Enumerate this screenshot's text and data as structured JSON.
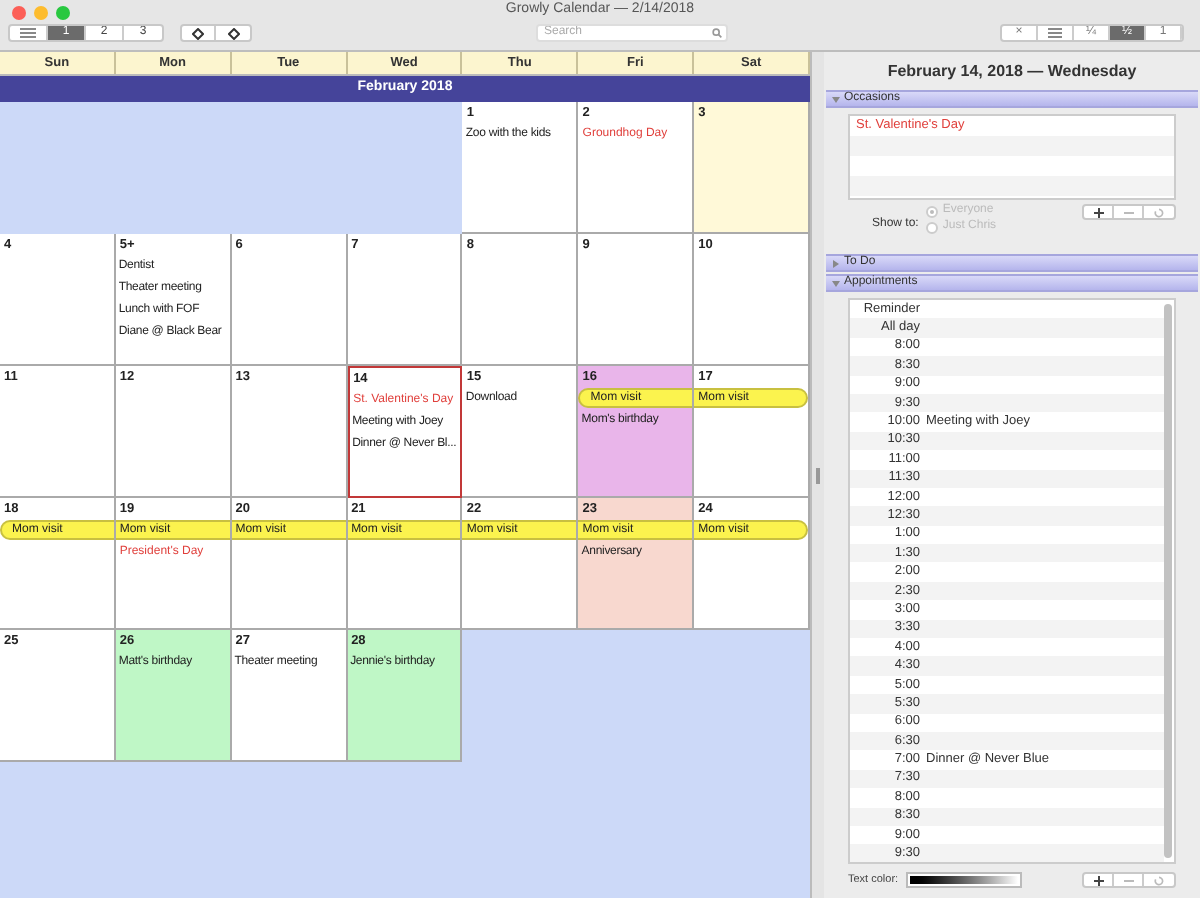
{
  "window": {
    "title": "Growly Calendar — 2/14/2018"
  },
  "toolbar": {
    "view_tabs": [
      {
        "label": "1",
        "selected": true
      },
      {
        "label": "2",
        "selected": false
      },
      {
        "label": "3",
        "selected": false
      }
    ],
    "search": {
      "placeholder": "Search"
    },
    "zoom_tabs": [
      {
        "label": "×",
        "selected": false
      },
      {
        "label": "¼",
        "selected": false
      },
      {
        "label": "½",
        "selected": true
      },
      {
        "label": "1",
        "selected": false
      }
    ]
  },
  "calendar": {
    "weekdays": [
      "Sun",
      "Mon",
      "Tue",
      "Wed",
      "Thu",
      "Fri",
      "Sat"
    ],
    "month": "February 2018",
    "weeks": [
      [
        {
          "kind": "blank"
        },
        {
          "kind": "blank"
        },
        {
          "kind": "blank"
        },
        {
          "kind": "blank"
        },
        {
          "kind": "day",
          "day": "1",
          "selected": false,
          "events": [
            {
              "kind": "plain",
              "text": "Zoo with the kids"
            }
          ]
        },
        {
          "kind": "day",
          "day": "2",
          "selected": false,
          "events": [
            {
              "kind": "holiday",
              "text": "Groundhog Day"
            }
          ]
        },
        {
          "kind": "day",
          "day": "3",
          "selected": false,
          "color": "#fff9d8"
        }
      ],
      [
        {
          "kind": "day",
          "day": "4",
          "selected": false
        },
        {
          "kind": "day",
          "day": "5+",
          "selected": false,
          "events": [
            {
              "kind": "plain",
              "text": "Dentist"
            },
            {
              "kind": "plain",
              "text": "Theater meeting"
            },
            {
              "kind": "plain",
              "text": "Lunch with FOF"
            },
            {
              "kind": "plain",
              "text": "Diane @ Black Bear"
            }
          ]
        },
        {
          "kind": "day",
          "day": "6",
          "selected": false
        },
        {
          "kind": "day",
          "day": "7",
          "selected": false
        },
        {
          "kind": "day",
          "day": "8",
          "selected": false
        },
        {
          "kind": "day",
          "day": "9",
          "selected": false
        },
        {
          "kind": "day",
          "day": "10",
          "selected": false
        }
      ],
      [
        {
          "kind": "day",
          "day": "11",
          "selected": false
        },
        {
          "kind": "day",
          "day": "12",
          "selected": false
        },
        {
          "kind": "day",
          "day": "13",
          "selected": false
        },
        {
          "kind": "day",
          "day": "14",
          "selected": true,
          "events": [
            {
              "kind": "holiday",
              "text": "St. Valentine's Day"
            },
            {
              "kind": "plain",
              "text": "Meeting with Joey"
            },
            {
              "kind": "plain",
              "text": "Dinner @ Never Bl..."
            }
          ]
        },
        {
          "kind": "day",
          "day": "15",
          "selected": false,
          "events": [
            {
              "kind": "plain",
              "text": "Download"
            }
          ]
        },
        {
          "kind": "day",
          "day": "16",
          "selected": false,
          "color": "#e9b5ea",
          "events": [
            {
              "kind": "span",
              "text": "Mom visit"
            },
            {
              "kind": "plain",
              "text": "Mom's birthday"
            }
          ]
        },
        {
          "kind": "day",
          "day": "17",
          "selected": false,
          "events": [
            {
              "kind": "span",
              "text": "Mom visit"
            }
          ]
        }
      ],
      [
        {
          "kind": "day",
          "day": "18",
          "selected": false,
          "events": [
            {
              "kind": "span",
              "text": "Mom visit"
            }
          ]
        },
        {
          "kind": "day",
          "day": "19",
          "selected": false,
          "events": [
            {
              "kind": "span",
              "text": "Mom visit"
            },
            {
              "kind": "holiday",
              "text": "President's Day"
            }
          ]
        },
        {
          "kind": "day",
          "day": "20",
          "selected": false,
          "events": [
            {
              "kind": "span",
              "text": "Mom visit"
            }
          ]
        },
        {
          "kind": "day",
          "day": "21",
          "selected": false,
          "events": [
            {
              "kind": "span",
              "text": "Mom visit"
            }
          ]
        },
        {
          "kind": "day",
          "day": "22",
          "selected": false,
          "events": [
            {
              "kind": "span",
              "text": "Mom visit"
            }
          ]
        },
        {
          "kind": "day",
          "day": "23",
          "selected": false,
          "color": "#f8d8cf",
          "events": [
            {
              "kind": "span",
              "text": "Mom visit"
            },
            {
              "kind": "plain",
              "text": "Anniversary"
            }
          ]
        },
        {
          "kind": "day",
          "day": "24",
          "selected": false,
          "events": [
            {
              "kind": "span",
              "text": "Mom visit"
            }
          ]
        }
      ],
      [
        {
          "kind": "day",
          "day": "25",
          "selected": false
        },
        {
          "kind": "day",
          "day": "26",
          "selected": false,
          "color": "#bff7c6",
          "events": [
            {
              "kind": "plain",
              "text": "Matt's birthday"
            }
          ]
        },
        {
          "kind": "day",
          "day": "27",
          "selected": false,
          "events": [
            {
              "kind": "plain",
              "text": "Theater meeting"
            }
          ]
        },
        {
          "kind": "day",
          "day": "28",
          "selected": false,
          "color": "#bff7c6",
          "events": [
            {
              "kind": "plain",
              "text": "Jennie's birthday"
            }
          ]
        },
        {
          "kind": "blank"
        },
        {
          "kind": "blank"
        },
        {
          "kind": "blank"
        }
      ]
    ]
  },
  "detail": {
    "date": "February 14, 2018 — Wednesday",
    "occasions": {
      "title": "Occasions",
      "expanded": true,
      "items": [
        "St. Valentine's Day"
      ],
      "show_to_label": "Show to:",
      "options": [
        {
          "label": "Everyone",
          "selected": true,
          "disabled": true
        },
        {
          "label": "Just Chris",
          "selected": false,
          "disabled": true
        }
      ]
    },
    "todo": {
      "title": "To Do",
      "expanded": false
    },
    "appointments": {
      "title": "Appointments",
      "expanded": true,
      "rows": [
        {
          "time": "Reminder"
        },
        {
          "time": "All day"
        },
        {
          "time": "8:00"
        },
        {
          "time": "8:30"
        },
        {
          "time": "9:00"
        },
        {
          "time": "9:30"
        },
        {
          "time": "10:00",
          "text": "Meeting with Joey"
        },
        {
          "time": "10:30"
        },
        {
          "time": "11:00"
        },
        {
          "time": "11:30"
        },
        {
          "time": "12:00"
        },
        {
          "time": "12:30"
        },
        {
          "time": "1:00"
        },
        {
          "time": "1:30"
        },
        {
          "time": "2:00"
        },
        {
          "time": "2:30"
        },
        {
          "time": "3:00"
        },
        {
          "time": "3:30"
        },
        {
          "time": "4:00"
        },
        {
          "time": "4:30"
        },
        {
          "time": "5:00"
        },
        {
          "time": "5:30"
        },
        {
          "time": "6:00"
        },
        {
          "time": "6:30"
        },
        {
          "time": "7:00",
          "text": "Dinner @ Never Blue"
        },
        {
          "time": "7:30"
        },
        {
          "time": "8:00"
        },
        {
          "time": "8:30"
        },
        {
          "time": "9:00"
        },
        {
          "time": "9:30"
        }
      ],
      "text_color_label": "Text color:"
    }
  }
}
